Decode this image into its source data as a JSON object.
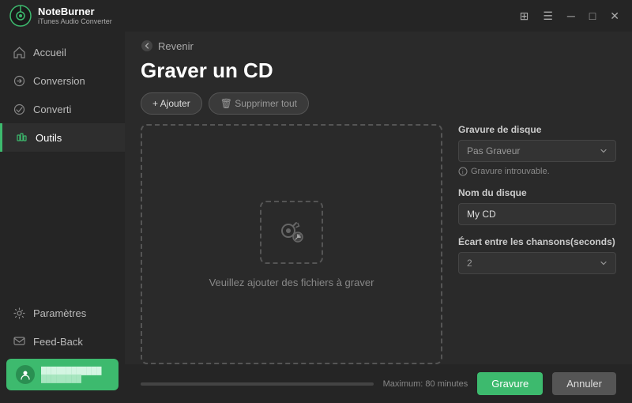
{
  "titleBar": {
    "appName": "NoteBurner",
    "appSub": "iTunes Audio Converter",
    "controls": [
      "grid-icon",
      "menu-icon",
      "minimize-icon",
      "maximize-icon",
      "close-icon"
    ]
  },
  "sidebar": {
    "items": [
      {
        "id": "accueil",
        "label": "Accueil",
        "icon": "home-icon",
        "active": false
      },
      {
        "id": "conversion",
        "label": "Conversion",
        "icon": "conversion-icon",
        "active": false
      },
      {
        "id": "converti",
        "label": "Converti",
        "icon": "converted-icon",
        "active": false
      },
      {
        "id": "outils",
        "label": "Outils",
        "icon": "tools-icon",
        "active": true
      }
    ],
    "bottomItems": [
      {
        "id": "parametres",
        "label": "Paramètres",
        "icon": "settings-icon"
      },
      {
        "id": "feedback",
        "label": "Feed-Back",
        "icon": "feedback-icon"
      }
    ],
    "user": {
      "line1": "user@example.com",
      "line2": "account info"
    }
  },
  "nav": {
    "backLabel": "Revenir"
  },
  "page": {
    "title": "Graver un CD",
    "addLabel": "+ Ajouter",
    "deleteLabel": "🗑 Supprimer tout",
    "dropPlaceholder": "Veuillez ajouter des fichiers à graver"
  },
  "rightPanel": {
    "discLabel": "Gravure de disque",
    "discPlaceholder": "Pas Graveur",
    "discHint": "Gravure introuvable.",
    "diskNameLabel": "Nom du disque",
    "diskNameValue": "My CD",
    "gapLabel": "Écart entre les chansons(seconds)",
    "gapValue": "2"
  },
  "bottomBar": {
    "progressLabel": "Maximum: 80 minutes",
    "burnLabel": "Gravure",
    "cancelLabel": "Annuler"
  }
}
